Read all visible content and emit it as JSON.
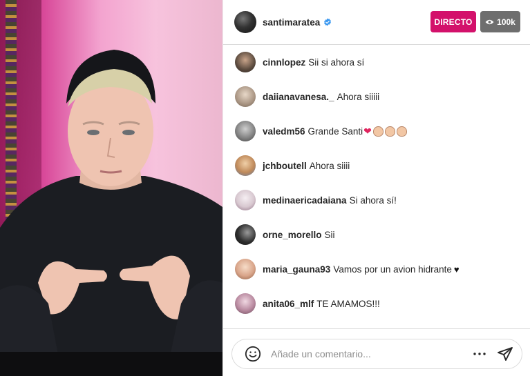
{
  "header": {
    "username": "santimaratea",
    "live_label": "DIRECTO",
    "viewers": "100k"
  },
  "comments": [
    {
      "user": "cinnlopez",
      "text": "Sii si ahora sí",
      "avatar_color": "#5a4a3e"
    },
    {
      "user": "daiianavanesa._",
      "text": "Ahora siiiii",
      "avatar_color": "#a89482"
    },
    {
      "user": "valedm56",
      "text": "Grande Santi",
      "avatar_color": "#7d7d7d",
      "emojis": [
        "red-heart",
        "clap",
        "clap",
        "clap"
      ]
    },
    {
      "user": "jchboutell",
      "text": "Ahora siiii",
      "avatar_color": "#c08a5a"
    },
    {
      "user": "medinaericadaiana",
      "text": "Si ahora sí!",
      "avatar_color": "#d8c8d0"
    },
    {
      "user": "orne_morello",
      "text": "Sii",
      "avatar_color": "#2e2e2e"
    },
    {
      "user": "maria_gauna93",
      "text": "Vamos por un avion hidrante",
      "avatar_color": "#d9a58a",
      "emojis": [
        "black-heart"
      ]
    },
    {
      "user": "anita06_mlf",
      "text": "TE AMAMOS!!!",
      "avatar_color": "#b98aa0"
    }
  ],
  "composer": {
    "placeholder": "Añade un comentario..."
  },
  "icons": {
    "verified": "verified-badge-icon",
    "eye": "eye-icon",
    "emoji": "emoji-smile-icon",
    "more": "more-dots-icon",
    "send": "send-icon"
  },
  "colors": {
    "live_badge": "#d3116b",
    "viewer_badge": "#6e6e6e",
    "verified": "#3897f0"
  }
}
